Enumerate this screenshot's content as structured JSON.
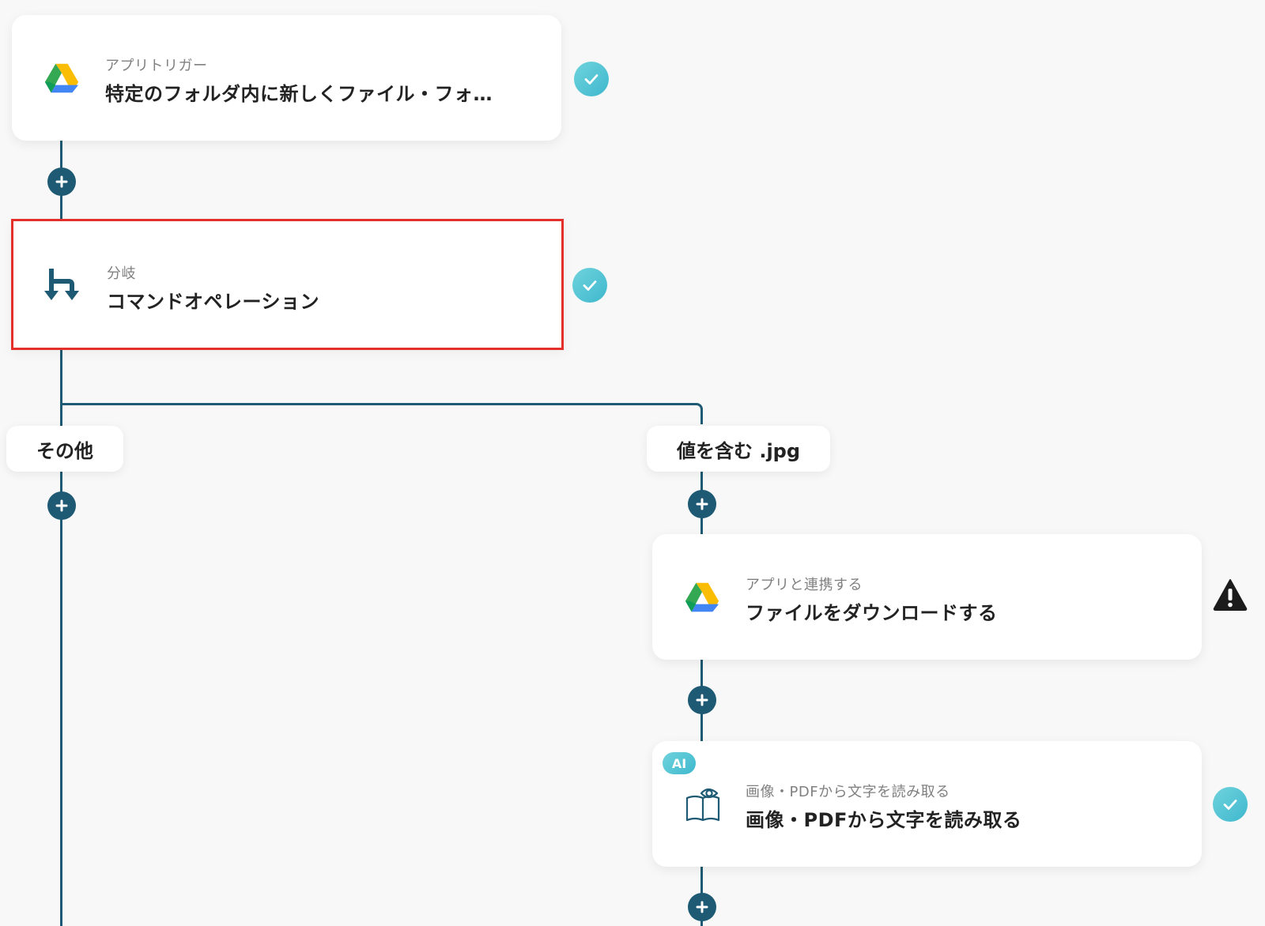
{
  "nodes": {
    "trigger": {
      "subtitle": "アプリトリガー",
      "title": "特定のフォルダ内に新しくファイル・フォ…",
      "icon": "google-drive-icon",
      "status": "check-icon"
    },
    "branch": {
      "subtitle": "分岐",
      "title": "コマンドオペレーション",
      "icon": "branch-icon",
      "status": "check-icon"
    },
    "download": {
      "subtitle": "アプリと連携する",
      "title": "ファイルをダウンロードする",
      "icon": "google-drive-icon",
      "status": "warning-icon"
    },
    "ocr": {
      "badge": "AI",
      "subtitle": "画像・PDFから文字を読み取る",
      "title": "画像・PDFから文字を読み取る",
      "icon": "ocr-book-eye-icon",
      "status": "check-icon"
    }
  },
  "branches": {
    "left_label": "その他",
    "right_label": "値を含む .jpg"
  },
  "colors": {
    "line": "#1e5a73",
    "selected_border": "#e2302a",
    "status_check": "#3fb8ce",
    "background": "#f8f8f8"
  }
}
